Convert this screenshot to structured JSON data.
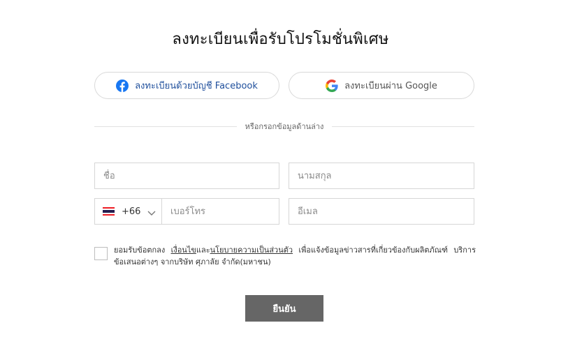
{
  "title": "ลงทะเบียนเพื่อรับโปรโมชั่นพิเศษ",
  "social": {
    "facebook_label": "ลงทะเบียนด้วยบัญชี Facebook",
    "google_label": "ลงทะเบียนผ่าน Google",
    "facebook_icon": "facebook-icon",
    "google_icon": "google-icon",
    "facebook_color": "#1877f2"
  },
  "divider_text": "หรือกรอกข้อมูลด้านล่าง",
  "form": {
    "first_name_placeholder": "ชื่อ",
    "last_name_placeholder": "นามสกุล",
    "country_flag": "thailand-flag-icon",
    "country_code": "+66",
    "phone_placeholder": "เบอร์โทร",
    "email_placeholder": "อีเมล"
  },
  "consent": {
    "prefix": "ยอมรับข้อตกลง ",
    "terms_link": "เงื่อนไข",
    "and": "และ",
    "privacy_link": "นโยบายความเป็นส่วนตัว",
    "suffix": " เพื่อแจ้งข้อมูลข่าวสารที่เกี่ยวข้องกับผลิตภัณฑ์ บริการ ข้อเสนอต่างๆ จากบริษัท ศุภาลัย จำกัด(มหาชน)"
  },
  "submit_label": "ยืนยัน",
  "colors": {
    "submit_bg": "#666666",
    "border": "#d6d6d6"
  }
}
